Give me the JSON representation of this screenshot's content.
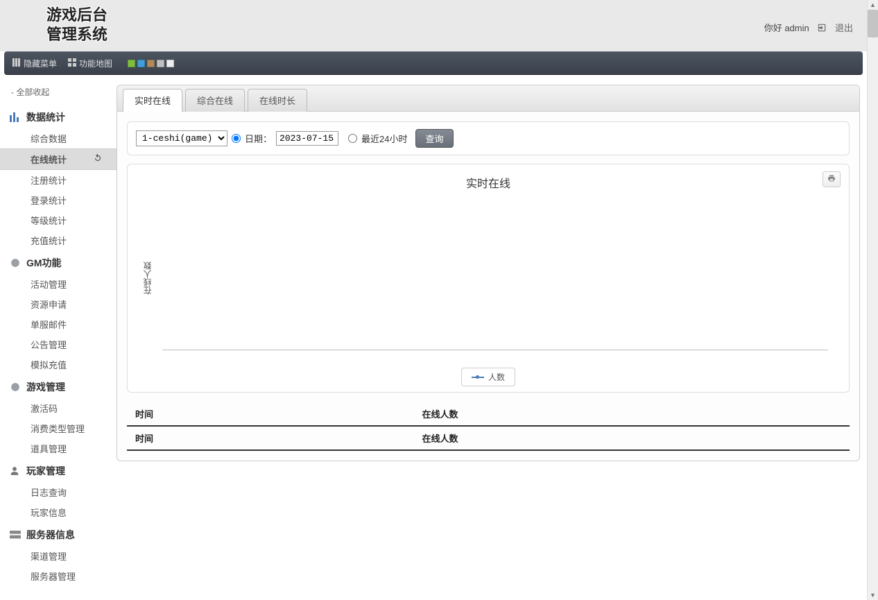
{
  "app": {
    "title_line1": "游戏后台",
    "title_line2": "管理系统"
  },
  "header": {
    "greeting": "你好 admin",
    "logout": "退出"
  },
  "toolbar": {
    "hide_menu": "隐藏菜单",
    "sitemap": "功能地图",
    "swatches": [
      "#7fbf3f",
      "#3fa0d8",
      "#b08a5a",
      "#c0c0c0",
      "#eee"
    ]
  },
  "sidebar": {
    "collapse_all": "- 全部收起",
    "groups": [
      {
        "title": "数据统计",
        "icon": "bars-icon",
        "items": [
          "综合数据",
          "在线统计",
          "注册统计",
          "登录统计",
          "等级统计",
          "充值统计"
        ],
        "active_index": 1
      },
      {
        "title": "GM功能",
        "icon": "chat-icon",
        "items": [
          "活动管理",
          "资源申请",
          "单服邮件",
          "公告管理",
          "模拟充值"
        ]
      },
      {
        "title": "游戏管理",
        "icon": "chat-icon",
        "items": [
          "激活码",
          "消费类型管理",
          "道具管理"
        ]
      },
      {
        "title": "玩家管理",
        "icon": "user-icon",
        "items": [
          "日志查询",
          "玩家信息"
        ]
      },
      {
        "title": "服务器信息",
        "icon": "server-icon",
        "items": [
          "渠道管理",
          "服务器管理"
        ]
      }
    ]
  },
  "tabs": {
    "items": [
      "实时在线",
      "综合在线",
      "在线时长"
    ],
    "active_index": 0
  },
  "query": {
    "server_options": [
      "1-ceshi(game)"
    ],
    "server_selected": "1-ceshi(game)",
    "mode_date_label": "日期：",
    "date_value": "2023-07-15",
    "mode_24h_label": "最近24小时",
    "submit": "查询",
    "mode_selected": "date"
  },
  "chart_data": {
    "type": "line",
    "title": "实时在线",
    "ylabel": "在线人数",
    "xlabel": "",
    "series": [
      {
        "name": "人数",
        "values": []
      }
    ],
    "categories": []
  },
  "table": {
    "headers": [
      "时间",
      "在线人数"
    ],
    "rows": [],
    "footer": [
      "时间",
      "在线人数"
    ]
  }
}
